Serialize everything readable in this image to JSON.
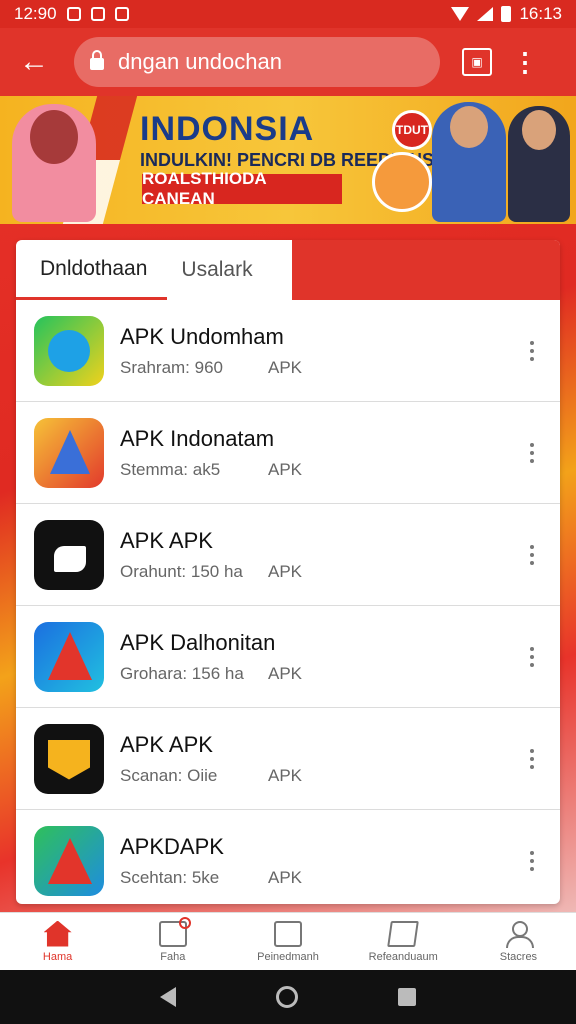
{
  "status_bar": {
    "time": "12:90",
    "right_time": "16:13"
  },
  "app_bar": {
    "url": "dngan undochan"
  },
  "banner": {
    "title": "INDONSIA",
    "subtitle": "INDULKIN! PENCRI DB REEDUINS",
    "ribbon": "ROALSTHIODA CANEAN",
    "badge": "TDUT"
  },
  "tabs": [
    {
      "label": "Dnldothaan"
    },
    {
      "label": "Usalark"
    }
  ],
  "apps": [
    {
      "name": "APK Undomham",
      "size": "Srahram: 960",
      "type": "APK",
      "icon": "green-clock-icon"
    },
    {
      "name": "APK Indonatam",
      "size": "Stemma: ak5",
      "type": "APK",
      "icon": "triangle-card-icon"
    },
    {
      "name": "APK APK",
      "size": "Orahunt: 150 ha",
      "type": "APK",
      "icon": "black-bird-icon"
    },
    {
      "name": "APK Dalhonitan",
      "size": "Grohara: 156 ha",
      "type": "APK",
      "icon": "blue-triangle-icon"
    },
    {
      "name": "APK  APK",
      "size": "Scanan: Oiie",
      "type": "APK",
      "icon": "yellow-shield-icon"
    },
    {
      "name": "APKDAPK",
      "size": "Scehtan: 5ke",
      "type": "APK",
      "icon": "green-triangle-icon"
    }
  ],
  "bottom_nav": [
    {
      "label": "Hama",
      "icon": "home-icon"
    },
    {
      "label": "Faha",
      "icon": "package-icon"
    },
    {
      "label": "Peinedmanh",
      "icon": "card-icon"
    },
    {
      "label": "Refeanduaum",
      "icon": "note-icon"
    },
    {
      "label": "Stacres",
      "icon": "user-icon"
    }
  ],
  "colors": {
    "accent": "#e0342a",
    "banner": "#f5b320"
  }
}
